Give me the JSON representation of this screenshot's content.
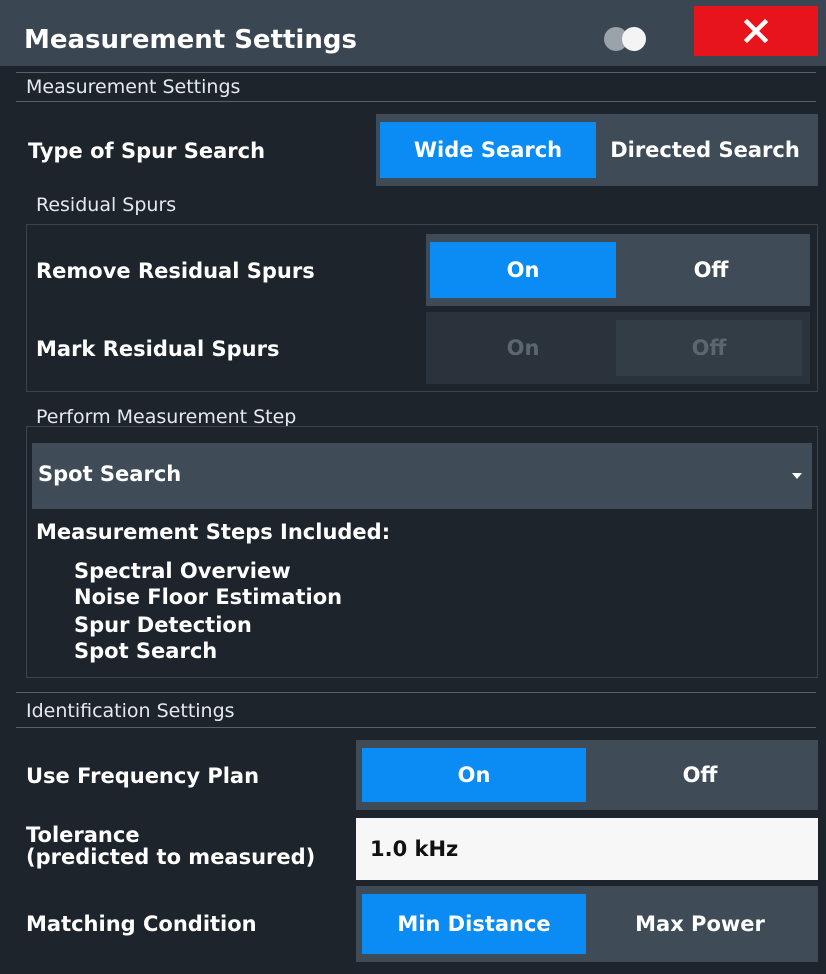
{
  "window": {
    "title": "Measurement Settings"
  },
  "sections": {
    "measurement": {
      "header": "Measurement Settings"
    },
    "residual": {
      "header": "Residual Spurs"
    },
    "perform": {
      "header": "Perform Measurement Step"
    },
    "identification": {
      "header": "Identification Settings"
    }
  },
  "spur_search": {
    "label": "Type of Spur Search",
    "options": [
      "Wide Search",
      "Directed Search"
    ],
    "selected": "Wide Search"
  },
  "remove_residual": {
    "label": "Remove Residual Spurs",
    "options": [
      "On",
      "Off"
    ],
    "selected": "On"
  },
  "mark_residual": {
    "label": "Mark Residual Spurs",
    "options": [
      "On",
      "Off"
    ],
    "selected": "Off",
    "enabled": false
  },
  "measurement_step": {
    "selected": "Spot Search",
    "included_title": "Measurement Steps Included:",
    "included": [
      "Spectral Overview",
      "Noise Floor Estimation",
      "Spur Detection",
      "Spot Search"
    ]
  },
  "frequency_plan": {
    "label": "Use Frequency Plan",
    "options": [
      "On",
      "Off"
    ],
    "selected": "On"
  },
  "tolerance": {
    "label_line1": "Tolerance",
    "label_line2": "(predicted to measured)",
    "value": "1.0 kHz"
  },
  "matching": {
    "label": "Matching Condition",
    "options": [
      "Min Distance",
      "Max Power"
    ],
    "selected": "Min Distance"
  },
  "colors": {
    "accent": "#0a8cf4",
    "close": "#e8141b",
    "background": "#1d242b"
  }
}
